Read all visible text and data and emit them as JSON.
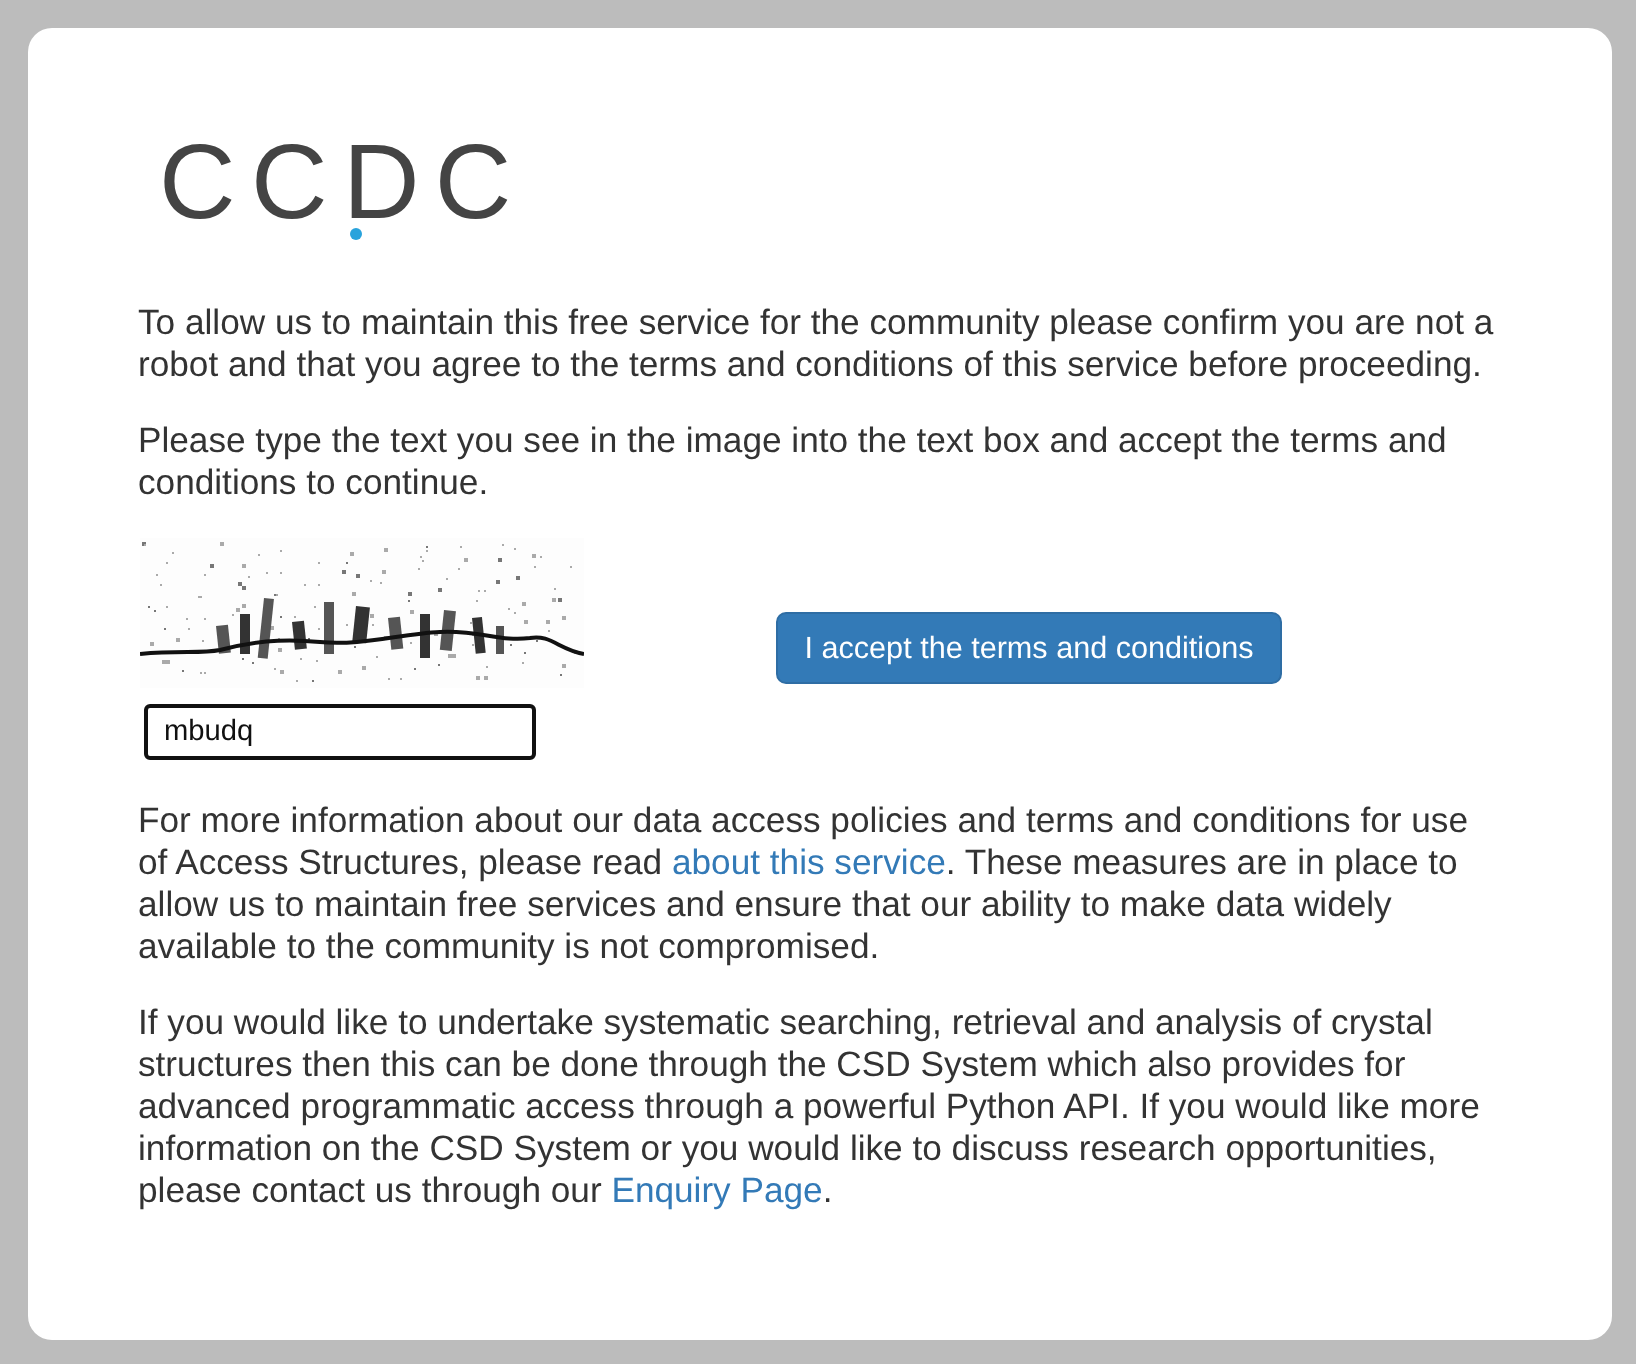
{
  "logo": {
    "text": "CCDC"
  },
  "intro": [
    "To allow us to maintain this free service for the community please confirm you are not a robot and that you agree to the terms and conditions of this service before proceeding.",
    "Please type the text you see in the image into the text box and accept the terms and conditions to continue."
  ],
  "captcha": {
    "answer": {
      "value": "mbudq"
    },
    "accept_button": "I accept the terms and conditions"
  },
  "info": [
    {
      "before": "For more information about our data access policies and terms and conditions for use of Access Structures, please read ",
      "link": "about this service",
      "after": ". These measures are in place to allow us to maintain free services and ensure that our ability to make data widely available to the community is not compromised."
    },
    {
      "before": "If you would like to undertake systematic searching, retrieval and analysis of crystal structures then this can be done through the CSD System which also provides for advanced programmatic access through a powerful Python API. If you would like more information on the CSD System or you would like to discuss research opportunities, please contact us through our ",
      "link": "Enquiry Page",
      "after": "."
    }
  ]
}
